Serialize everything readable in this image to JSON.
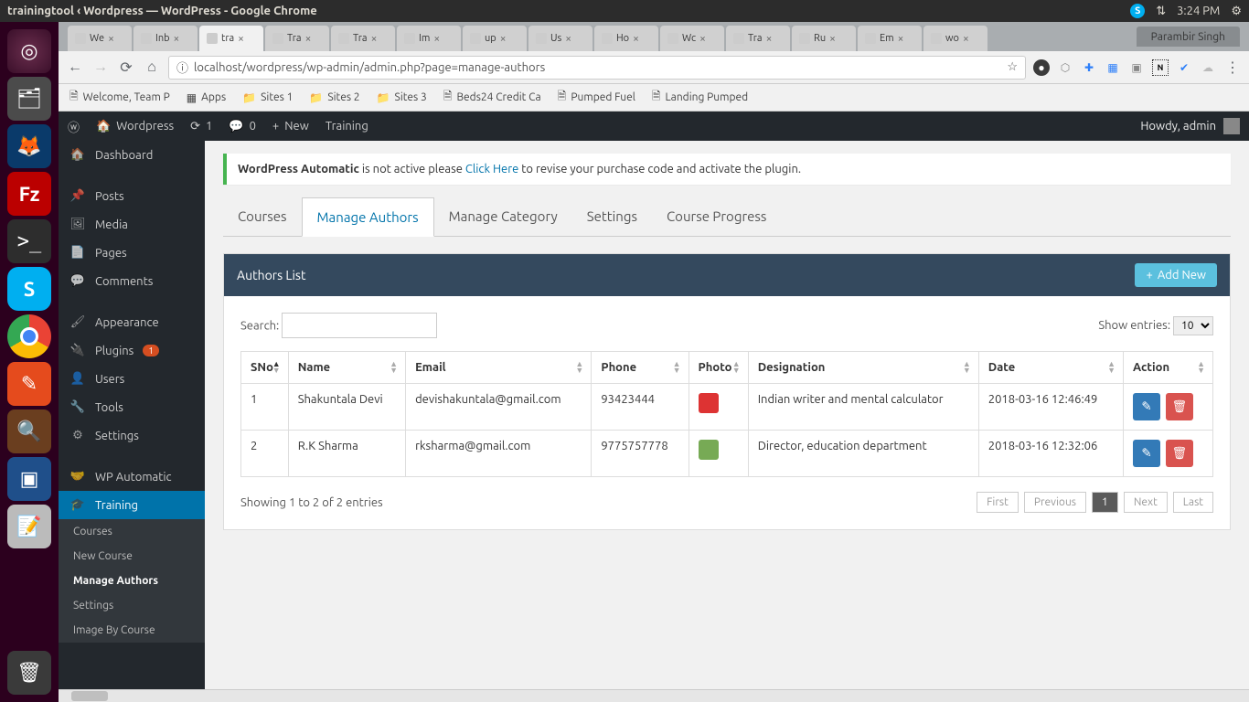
{
  "ubuntu": {
    "window_title": "trainingtool ‹ Wordpress — WordPress - Google Chrome",
    "time": "3:24 PM"
  },
  "chrome": {
    "user": "Parambir Singh",
    "tabs": [
      {
        "label": "We",
        "active": false
      },
      {
        "label": "Inb",
        "active": false
      },
      {
        "label": "tra",
        "active": true
      },
      {
        "label": "Tra",
        "active": false
      },
      {
        "label": "Tra",
        "active": false
      },
      {
        "label": "Im",
        "active": false
      },
      {
        "label": "up",
        "active": false
      },
      {
        "label": "Us",
        "active": false
      },
      {
        "label": "Ho",
        "active": false
      },
      {
        "label": "Wc",
        "active": false
      },
      {
        "label": "Tra",
        "active": false
      },
      {
        "label": "Ru",
        "active": false
      },
      {
        "label": "Em",
        "active": false
      },
      {
        "label": "wo",
        "active": false
      }
    ],
    "url": "localhost/wordpress/wp-admin/admin.php?page=manage-authors",
    "bookmarks": [
      "Welcome, Team P",
      "Apps",
      "Sites 1",
      "Sites 2",
      "Sites 3",
      "Beds24 Credit Ca",
      "Pumped Fuel",
      "Landing Pumped"
    ]
  },
  "wp_adminbar": {
    "site": "Wordpress",
    "refresh_count": "1",
    "comments_count": "0",
    "new_label": "New",
    "training_label": "Training",
    "howdy": "Howdy, admin"
  },
  "wp_sidebar": {
    "items": [
      {
        "label": "Dashboard",
        "icon": "dashboard"
      },
      {
        "label": "Posts",
        "icon": "pin"
      },
      {
        "label": "Media",
        "icon": "media"
      },
      {
        "label": "Pages",
        "icon": "pages"
      },
      {
        "label": "Comments",
        "icon": "comment"
      },
      {
        "label": "Appearance",
        "icon": "brush"
      },
      {
        "label": "Plugins",
        "icon": "plug",
        "badge": "1"
      },
      {
        "label": "Users",
        "icon": "user"
      },
      {
        "label": "Tools",
        "icon": "wrench"
      },
      {
        "label": "Settings",
        "icon": "sliders"
      },
      {
        "label": "WP Automatic",
        "icon": "handshake"
      },
      {
        "label": "Training",
        "icon": "grad",
        "active": true
      }
    ],
    "submenu": [
      "Courses",
      "New Course",
      "Manage Authors",
      "Settings",
      "Image By Course"
    ],
    "submenu_active": "Manage Authors"
  },
  "notice": {
    "prefix": "WordPress Automatic",
    "mid": " is not active please ",
    "link": "Click Here",
    "suffix": " to revise your purchase code and activate the plugin."
  },
  "tabs": {
    "items": [
      "Courses",
      "Manage Authors",
      "Manage Category",
      "Settings",
      "Course Progress"
    ],
    "active": "Manage Authors"
  },
  "panel": {
    "title": "Authors List",
    "add_new": "Add New"
  },
  "datatable": {
    "search_label": "Search:",
    "show_entries_label": "Show entries:",
    "show_entries_value": "10",
    "columns": [
      "SNo",
      "Name",
      "Email",
      "Phone",
      "Photo",
      "Designation",
      "Date",
      "Action"
    ],
    "rows": [
      {
        "sno": "1",
        "name": "Shakuntala Devi",
        "email": "devishakuntala@gmail.com",
        "phone": "93423444",
        "designation": "Indian writer and mental calculator",
        "date": "2018-03-16 12:46:49"
      },
      {
        "sno": "2",
        "name": "R.K Sharma",
        "email": "rksharma@gmail.com",
        "phone": "9775757778",
        "designation": "Director, education department",
        "date": "2018-03-16 12:32:06"
      }
    ],
    "info": "Showing 1 to 2 of 2 entries",
    "pager": {
      "first": "First",
      "prev": "Previous",
      "page": "1",
      "next": "Next",
      "last": "Last"
    }
  }
}
